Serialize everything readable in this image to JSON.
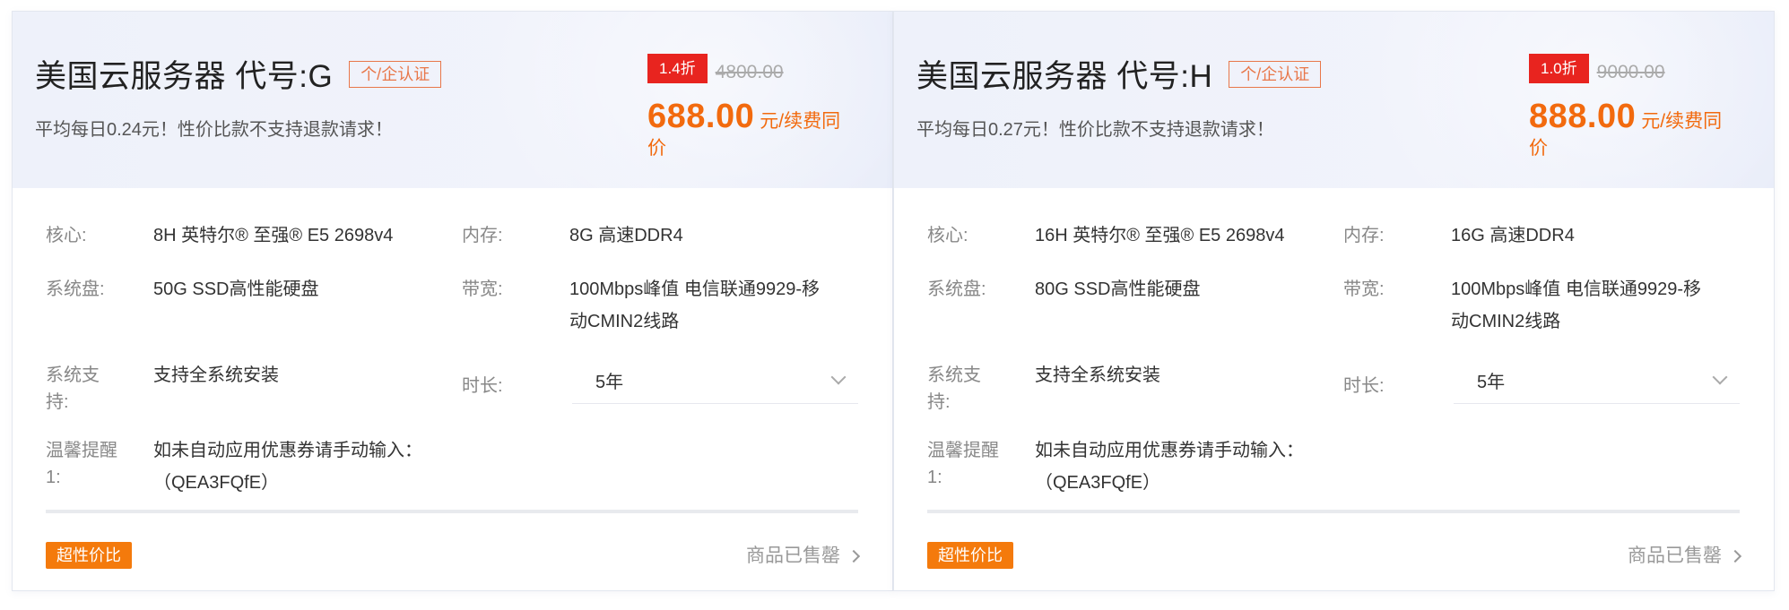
{
  "cards": [
    {
      "title": "美国云服务器 代号:G",
      "auth_badge": "个/企认证",
      "subtitle": "平均每日0.24元！性价比款不支持退款请求！",
      "discount": "1.4折",
      "original_price": "4800.00",
      "price": "688.00",
      "price_unit_line1": "元/续费同",
      "price_unit_line2": "价",
      "specs": {
        "core_label": "核心:",
        "core_value": "8H 英特尔® 至强® E5 2698v4",
        "memory_label": "内存:",
        "memory_value": "8G 高速DDR4",
        "disk_label": "系统盘:",
        "disk_value": "50G SSD高性能硬盘",
        "bandwidth_label": "带宽:",
        "bandwidth_value_line1": "100Mbps峰值 电信联通9929-移",
        "bandwidth_value_line2": "动CMIN2线路",
        "os_label_line1": "系统支",
        "os_label_line2": "持:",
        "os_value": "支持全系统安装",
        "duration_label": "时长:",
        "duration_value": "5年",
        "tip_label_line1": "温馨提醒",
        "tip_label_line2": "1:",
        "tip_value_line1": "如未自动应用优惠券请手动输入：",
        "tip_value_line2": "（QEA3FQfE）"
      },
      "tag": "超性价比",
      "status": "商品已售罄"
    },
    {
      "title": "美国云服务器 代号:H",
      "auth_badge": "个/企认证",
      "subtitle": "平均每日0.27元！性价比款不支持退款请求！",
      "discount": "1.0折",
      "original_price": "9000.00",
      "price": "888.00",
      "price_unit_line1": "元/续费同",
      "price_unit_line2": "价",
      "specs": {
        "core_label": "核心:",
        "core_value": "16H 英特尔® 至强® E5 2698v4",
        "memory_label": "内存:",
        "memory_value": "16G 高速DDR4",
        "disk_label": "系统盘:",
        "disk_value": "80G SSD高性能硬盘",
        "bandwidth_label": "带宽:",
        "bandwidth_value_line1": "100Mbps峰值 电信联通9929-移",
        "bandwidth_value_line2": "动CMIN2线路",
        "os_label_line1": "系统支",
        "os_label_line2": "持:",
        "os_value": "支持全系统安装",
        "duration_label": "时长:",
        "duration_value": "5年",
        "tip_label_line1": "温馨提醒",
        "tip_label_line2": "1:",
        "tip_value_line1": "如未自动应用优惠券请手动输入：",
        "tip_value_line2": "（QEA3FQfE）"
      },
      "tag": "超性价比",
      "status": "商品已售罄"
    }
  ],
  "colors": {
    "accent_orange": "#f26a0e",
    "discount_red": "#e8241f",
    "tag_orange": "#f47a0c",
    "auth_border": "#e8774a"
  }
}
